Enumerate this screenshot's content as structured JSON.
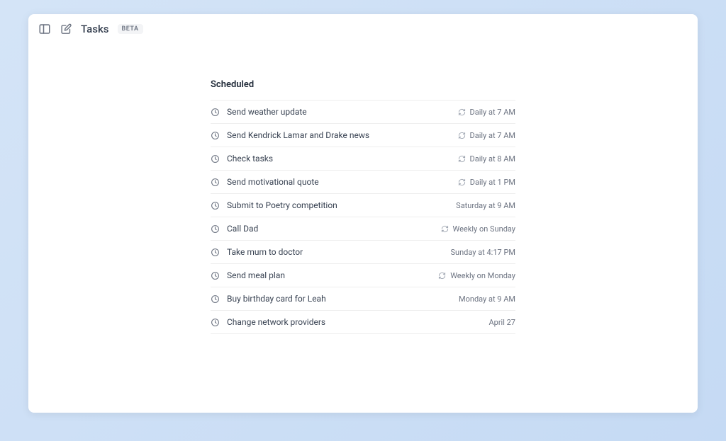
{
  "header": {
    "title": "Tasks",
    "badge": "BETA"
  },
  "section": {
    "title": "Scheduled"
  },
  "tasks": [
    {
      "title": "Send weather update",
      "schedule": "Daily at 7 AM",
      "recurring": true
    },
    {
      "title": "Send Kendrick Lamar and Drake news",
      "schedule": "Daily at 7 AM",
      "recurring": true
    },
    {
      "title": "Check tasks",
      "schedule": "Daily at 8 AM",
      "recurring": true
    },
    {
      "title": "Send motivational quote",
      "schedule": "Daily at 1 PM",
      "recurring": true
    },
    {
      "title": "Submit to Poetry competition",
      "schedule": "Saturday at 9 AM",
      "recurring": false
    },
    {
      "title": "Call Dad",
      "schedule": "Weekly on Sunday",
      "recurring": true
    },
    {
      "title": "Take mum to doctor",
      "schedule": "Sunday at 4:17 PM",
      "recurring": false
    },
    {
      "title": "Send meal plan",
      "schedule": "Weekly on Monday",
      "recurring": true
    },
    {
      "title": "Buy birthday card for Leah",
      "schedule": "Monday at 9 AM",
      "recurring": false
    },
    {
      "title": "Change network providers",
      "schedule": "April 27",
      "recurring": false
    }
  ]
}
